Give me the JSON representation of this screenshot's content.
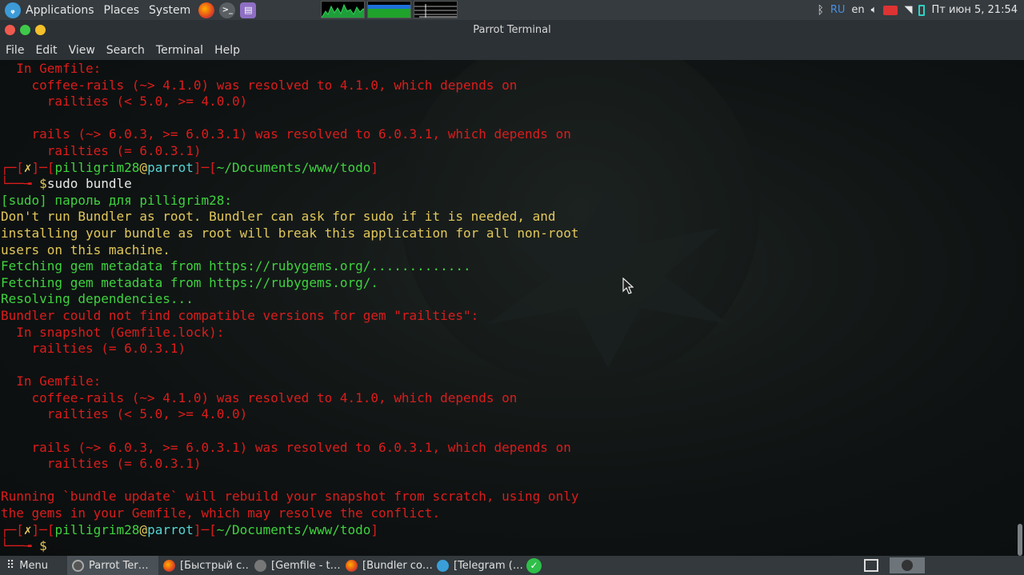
{
  "top_panel": {
    "applications": "Applications",
    "places": "Places",
    "system": "System",
    "clock": "Пт июн  5, 21:54",
    "lang_code": "RU",
    "lang_layout": "en"
  },
  "window": {
    "title": "Parrot Terminal"
  },
  "menubar": [
    "File",
    "Edit",
    "View",
    "Search",
    "Terminal",
    "Help"
  ],
  "terminal": {
    "lines": [
      {
        "segs": [
          {
            "t": "  In Gemfile:",
            "c": "red"
          }
        ]
      },
      {
        "segs": [
          {
            "t": "    coffee-rails (~> 4.1.0) was resolved to 4.1.0, which depends on",
            "c": "red"
          }
        ]
      },
      {
        "segs": [
          {
            "t": "      railties (< 5.0, >= 4.0.0)",
            "c": "red"
          }
        ]
      },
      {
        "segs": [
          {
            "t": "",
            "c": "red"
          }
        ]
      },
      {
        "segs": [
          {
            "t": "    rails (~> 6.0.3, >= 6.0.3.1) was resolved to 6.0.3.1, which depends on",
            "c": "red"
          }
        ]
      },
      {
        "segs": [
          {
            "t": "      railties (= 6.0.3.1)",
            "c": "red"
          }
        ]
      },
      {
        "segs": [
          {
            "t": "┌─[",
            "c": "red"
          },
          {
            "t": "✗",
            "c": "yellow"
          },
          {
            "t": "]─[",
            "c": "red"
          },
          {
            "t": "pilligrim28",
            "c": "green"
          },
          {
            "t": "@",
            "c": "yellow"
          },
          {
            "t": "parrot",
            "c": "cyan"
          },
          {
            "t": "]─[",
            "c": "red"
          },
          {
            "t": "~/Documents/www/todo",
            "c": "green"
          },
          {
            "t": "]",
            "c": "red"
          }
        ]
      },
      {
        "segs": [
          {
            "t": "└──╼ ",
            "c": "red"
          },
          {
            "t": "$",
            "c": "yellow"
          },
          {
            "t": "sudo bundle",
            "c": "white"
          }
        ]
      },
      {
        "segs": [
          {
            "t": "[sudo] пароль для pilligrim28:",
            "c": "green"
          }
        ]
      },
      {
        "segs": [
          {
            "t": "Don't run Bundler as root. Bundler can ask for sudo if it is needed, and",
            "c": "yellow"
          }
        ]
      },
      {
        "segs": [
          {
            "t": "installing your bundle as root will break this application for all non-root",
            "c": "yellow"
          }
        ]
      },
      {
        "segs": [
          {
            "t": "users on this machine.",
            "c": "yellow"
          }
        ]
      },
      {
        "segs": [
          {
            "t": "Fetching gem metadata from https://rubygems.org/.............",
            "c": "green"
          }
        ]
      },
      {
        "segs": [
          {
            "t": "Fetching gem metadata from https://rubygems.org/.",
            "c": "green"
          }
        ]
      },
      {
        "segs": [
          {
            "t": "Resolving dependencies...",
            "c": "green"
          }
        ]
      },
      {
        "segs": [
          {
            "t": "Bundler could not find compatible versions for gem \"railties\":",
            "c": "red"
          }
        ]
      },
      {
        "segs": [
          {
            "t": "  In snapshot (Gemfile.lock):",
            "c": "red"
          }
        ]
      },
      {
        "segs": [
          {
            "t": "    railties (= 6.0.3.1)",
            "c": "red"
          }
        ]
      },
      {
        "segs": [
          {
            "t": "",
            "c": "red"
          }
        ]
      },
      {
        "segs": [
          {
            "t": "  In Gemfile:",
            "c": "red"
          }
        ]
      },
      {
        "segs": [
          {
            "t": "    coffee-rails (~> 4.1.0) was resolved to 4.1.0, which depends on",
            "c": "red"
          }
        ]
      },
      {
        "segs": [
          {
            "t": "      railties (< 5.0, >= 4.0.0)",
            "c": "red"
          }
        ]
      },
      {
        "segs": [
          {
            "t": "",
            "c": "red"
          }
        ]
      },
      {
        "segs": [
          {
            "t": "    rails (~> 6.0.3, >= 6.0.3.1) was resolved to 6.0.3.1, which depends on",
            "c": "red"
          }
        ]
      },
      {
        "segs": [
          {
            "t": "      railties (= 6.0.3.1)",
            "c": "red"
          }
        ]
      },
      {
        "segs": [
          {
            "t": "",
            "c": "red"
          }
        ]
      },
      {
        "segs": [
          {
            "t": "Running `bundle update` will rebuild your snapshot from scratch, using only",
            "c": "red"
          }
        ]
      },
      {
        "segs": [
          {
            "t": "the gems in your Gemfile, which may resolve the conflict.",
            "c": "red"
          }
        ]
      },
      {
        "segs": [
          {
            "t": "┌─[",
            "c": "red"
          },
          {
            "t": "✗",
            "c": "yellow"
          },
          {
            "t": "]─[",
            "c": "red"
          },
          {
            "t": "pilligrim28",
            "c": "green"
          },
          {
            "t": "@",
            "c": "yellow"
          },
          {
            "t": "parrot",
            "c": "cyan"
          },
          {
            "t": "]─[",
            "c": "red"
          },
          {
            "t": "~/Documents/www/todo",
            "c": "green"
          },
          {
            "t": "]",
            "c": "red"
          }
        ]
      },
      {
        "segs": [
          {
            "t": "└──╼ ",
            "c": "red"
          },
          {
            "t": "$",
            "c": "yellow"
          }
        ]
      }
    ]
  },
  "taskbar": {
    "menu_label": "Menu",
    "tasks": [
      {
        "label": "Parrot Ter…",
        "icon": "terminal-icon",
        "active": true
      },
      {
        "label": "[Быстрый с…",
        "icon": "firefox-icon",
        "active": false
      },
      {
        "label": "[Gemfile - t…",
        "icon": "editor-icon",
        "active": false
      },
      {
        "label": "[Bundler co…",
        "icon": "firefox-icon",
        "active": false
      },
      {
        "label": "[Telegram (…",
        "icon": "telegram-icon",
        "active": false
      }
    ]
  },
  "colors": {
    "red": "#dc1c1c",
    "yellow": "#e2c75a",
    "green": "#3fd23f",
    "cyan": "#55d4d4",
    "panel": "#353b3f"
  }
}
